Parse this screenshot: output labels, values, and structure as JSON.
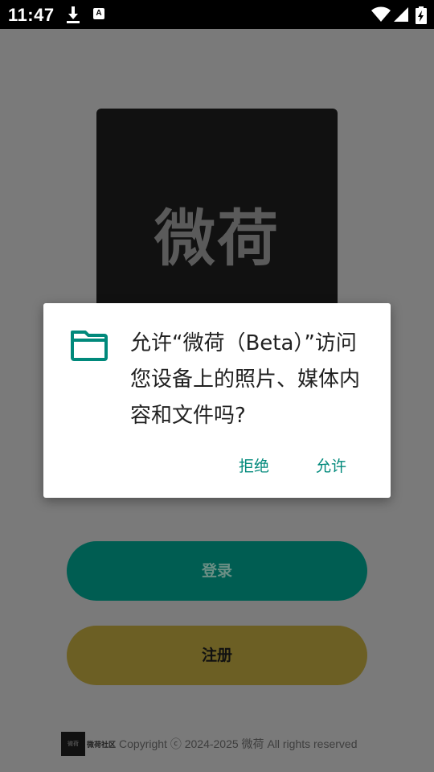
{
  "status_bar": {
    "time": "11:47",
    "icons": [
      "download-icon",
      "a-notification-icon",
      "wifi-icon",
      "signal-icon",
      "battery-charging-icon"
    ]
  },
  "app": {
    "logo_text": "微荷",
    "login_label": "登录",
    "register_label": "注册",
    "footer_logo_text": "微荷",
    "footer_brand": "微荷社区",
    "footer_copyright": "Copyright ⓒ 2024-2025 微荷 All rights reserved"
  },
  "dialog": {
    "icon": "folder-icon",
    "message": "允许“微荷（Beta）”访问您设备上的照片、媒体内容和文件吗?",
    "deny_label": "拒绝",
    "allow_label": "允许",
    "accent_color": "#00897b"
  }
}
